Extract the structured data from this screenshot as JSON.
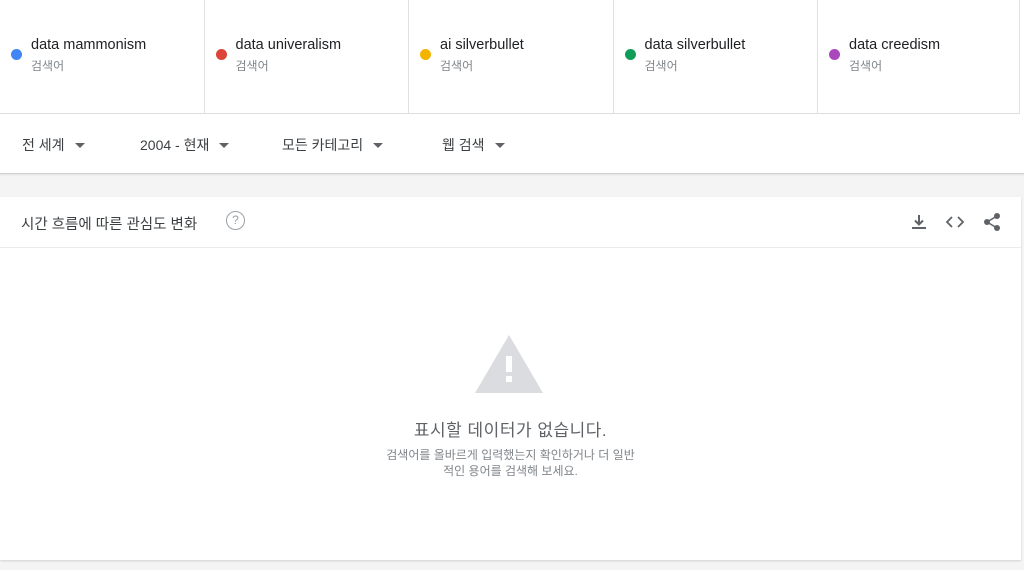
{
  "terms": [
    {
      "name": "data mammonism",
      "sub": "검색어",
      "color": "#4285f4"
    },
    {
      "name": "data univeralism",
      "sub": "검색어",
      "color": "#db4437"
    },
    {
      "name": "ai silverbullet",
      "sub": "검색어",
      "color": "#f4b400"
    },
    {
      "name": "data silverbullet",
      "sub": "검색어",
      "color": "#0f9d58"
    },
    {
      "name": "data creedism",
      "sub": "검색어",
      "color": "#ab47bc"
    }
  ],
  "filters": {
    "region": "전 세계",
    "time": "2004 - 현재",
    "category": "모든 카테고리",
    "search_type": "웹 검색"
  },
  "card": {
    "title": "시간 흐름에 따른 관심도 변화",
    "help": "?"
  },
  "empty": {
    "title": "표시할 데이터가 없습니다.",
    "desc_line1": "검색어를 올바르게 입력했는지 확인하거나 더 일반",
    "desc_line2": "적인 용어를 검색해 보세요."
  }
}
